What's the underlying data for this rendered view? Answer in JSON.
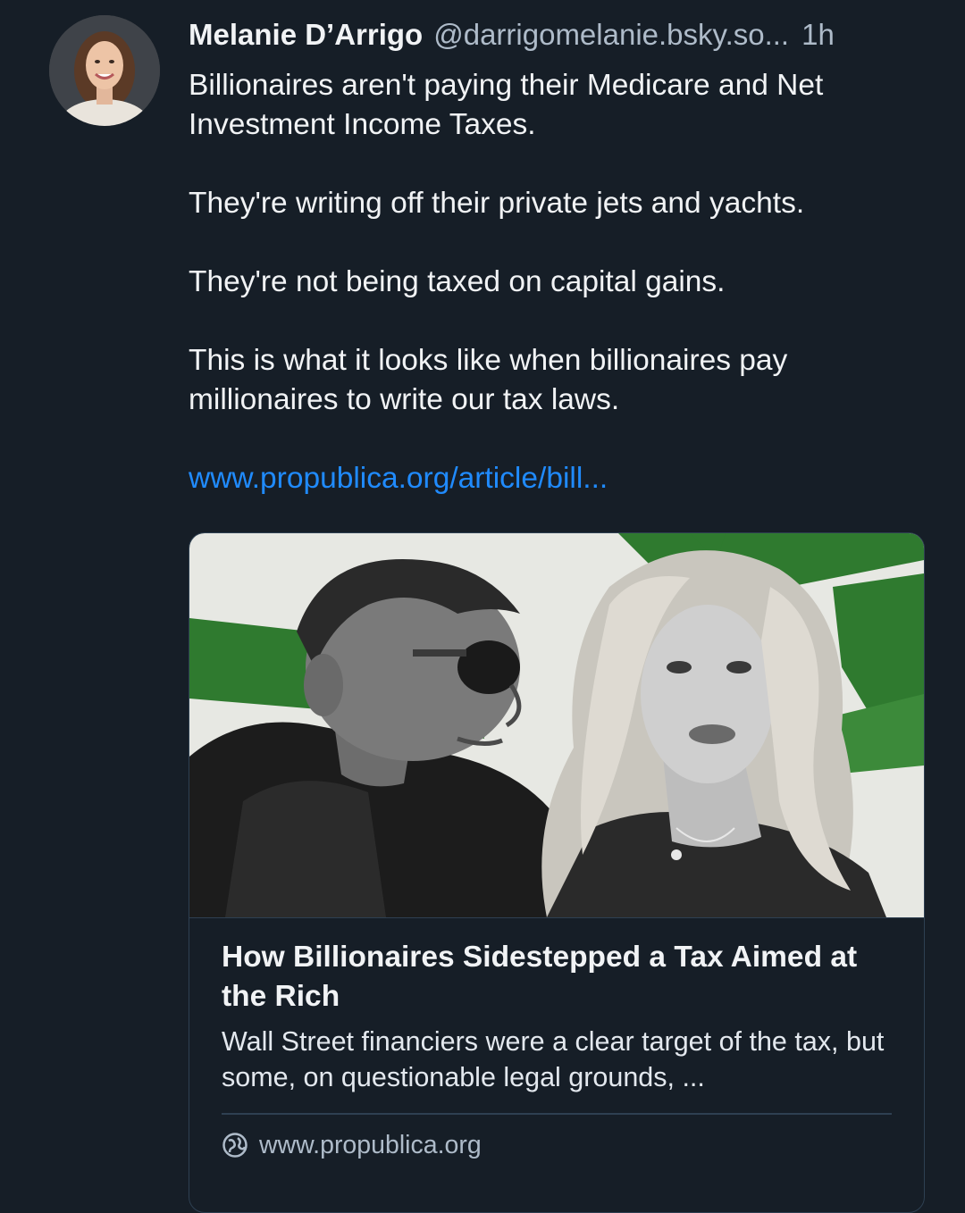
{
  "post": {
    "author": {
      "display_name": "Melanie D’Arrigo",
      "handle": "@darrigomelanie.bsky.so...",
      "avatar_icon": "avatar-photo"
    },
    "time": "1h",
    "paragraphs": [
      "Billionaires aren't paying their Medicare and Net Investment Income Taxes.",
      "They're writing off their private jets and yachts.",
      "They're not being taxed on capital gains.",
      "This is what it looks like when billionaires pay millionaires to write our tax laws."
    ],
    "link_text": "www.propublica.org/article/bill..."
  },
  "embed": {
    "image_icon": "article-thumbnail-image",
    "title": "How Billionaires Sidestepped a Tax Aimed at the Rich",
    "description": "Wall Street financiers were a clear target of the tax, but some, on questionable legal grounds, ...",
    "domain_icon": "globe-icon",
    "domain": "www.propublica.org"
  },
  "colors": {
    "background": "#161e27",
    "text": "#f1f3f5",
    "muted": "#aebbc9",
    "link": "#208bfe",
    "border": "#2e4052",
    "thumbnail_accent": "#2f7a2f"
  }
}
